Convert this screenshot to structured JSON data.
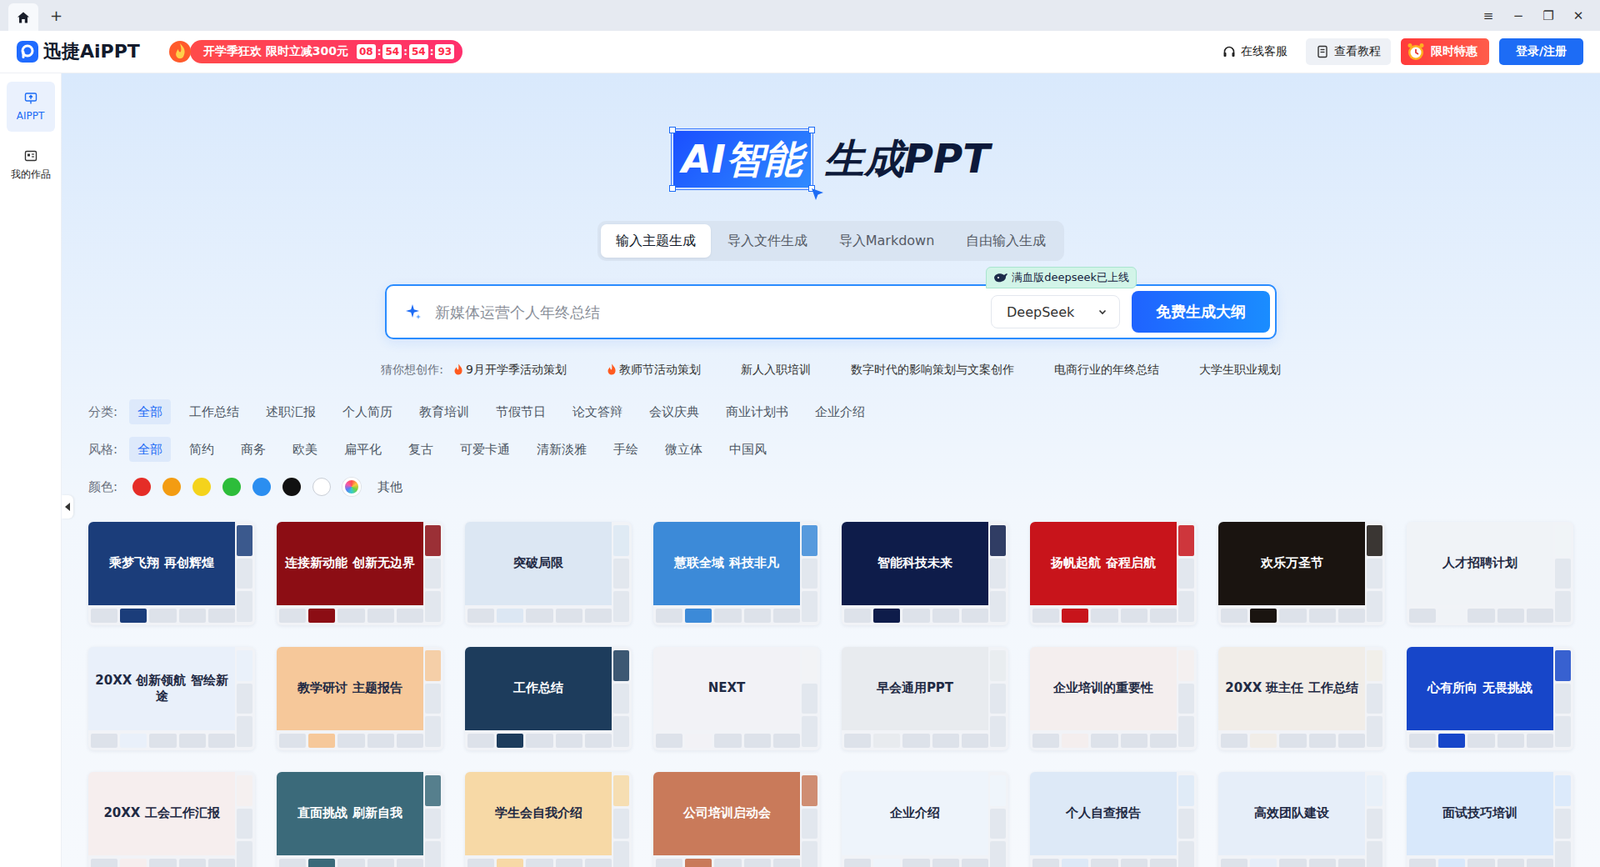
{
  "titlebar": {
    "tabs": [
      {
        "selected": true
      }
    ],
    "add": "+",
    "controls": [
      "≡",
      "−",
      "❐",
      "✕"
    ]
  },
  "app": {
    "logo": "迅捷AiPPT"
  },
  "promo": {
    "text": "开学季狂欢 限时立减300元",
    "countdown": [
      "08",
      "54",
      "54",
      "93"
    ],
    "separator": ":"
  },
  "header_actions": [
    {
      "label": "在线客服",
      "kind": "service"
    },
    {
      "label": "查看教程",
      "kind": "tutorial"
    },
    {
      "label": "限时特惠",
      "kind": "promo"
    },
    {
      "label": "登录/注册",
      "kind": "primary"
    }
  ],
  "sidebar": {
    "items": [
      {
        "label": "AIPPT",
        "selected": true,
        "kind": "aippt"
      },
      {
        "label": "我的作品",
        "selected": false,
        "kind": "works"
      }
    ]
  },
  "hero": {
    "highlight": "AI智能",
    "title": "生成PPT"
  },
  "modes": [
    {
      "label": "输入主题生成",
      "selected": true
    },
    {
      "label": "导入文件生成",
      "selected": false
    },
    {
      "label": "导入Markdown",
      "selected": false
    },
    {
      "label": "自由输入生成",
      "selected": false
    }
  ],
  "badge": "满血版deepseek已上线",
  "search": {
    "placeholder": "新媒体运营个人年终总结",
    "model": "DeepSeek",
    "button": "免费生成大纲"
  },
  "suggestions": {
    "label": "猜你想创作:",
    "items": [
      {
        "text": "9月开学季活动策划",
        "hot": true
      },
      {
        "text": "教师节活动策划",
        "hot": true
      },
      {
        "text": "新人入职培训",
        "hot": false
      },
      {
        "text": "数字时代的影响策划与文案创作",
        "hot": false
      },
      {
        "text": "电商行业的年终总结",
        "hot": false
      },
      {
        "text": "大学生职业规划",
        "hot": false
      }
    ]
  },
  "filters": [
    {
      "label": "分类:",
      "options": [
        {
          "text": "全部",
          "selected": true
        },
        {
          "text": "工作总结",
          "selected": false
        },
        {
          "text": "述职汇报",
          "selected": false
        },
        {
          "text": "个人简历",
          "selected": false
        },
        {
          "text": "教育培训",
          "selected": false
        },
        {
          "text": "节假节日",
          "selected": false
        },
        {
          "text": "论文答辩",
          "selected": false
        },
        {
          "text": "会议庆典",
          "selected": false
        },
        {
          "text": "商业计划书",
          "selected": false
        },
        {
          "text": "企业介绍",
          "selected": false
        }
      ]
    },
    {
      "label": "风格:",
      "options": [
        {
          "text": "全部",
          "selected": true
        },
        {
          "text": "简约",
          "selected": false
        },
        {
          "text": "商务",
          "selected": false
        },
        {
          "text": "欧美",
          "selected": false
        },
        {
          "text": "扁平化",
          "selected": false
        },
        {
          "text": "复古",
          "selected": false
        },
        {
          "text": "可爱卡通",
          "selected": false
        },
        {
          "text": "清新淡雅",
          "selected": false
        },
        {
          "text": "手绘",
          "selected": false
        },
        {
          "text": "微立体",
          "selected": false
        },
        {
          "text": "中国风",
          "selected": false
        }
      ]
    }
  ],
  "colors": {
    "label": "颜色:",
    "swatches": [
      {
        "kind": "solid",
        "color": "#e52d27",
        "selected": false
      },
      {
        "kind": "solid",
        "color": "#f39c12",
        "selected": false
      },
      {
        "kind": "solid",
        "color": "#f4d31c",
        "selected": false
      },
      {
        "kind": "solid",
        "color": "#2dbd3a",
        "selected": false
      },
      {
        "kind": "solid",
        "color": "#2b8ef0",
        "selected": false
      },
      {
        "kind": "solid",
        "color": "#111111",
        "selected": false
      },
      {
        "kind": "solid",
        "color": "#ffffff",
        "selected": false
      },
      {
        "kind": "multi",
        "selected": false
      }
    ],
    "other": "其他"
  },
  "templates": [
    {
      "title": "乘梦飞翔 再创辉煌",
      "color": "#1b3d7a"
    },
    {
      "title": "连接新动能 创新无边界",
      "color": "#8c0d14"
    },
    {
      "title": "突破局限",
      "color": "#dce7f3"
    },
    {
      "title": "慧联全域 科技非凡",
      "color": "#3c8ad8"
    },
    {
      "title": "智能科技未来",
      "color": "#0e1c4a"
    },
    {
      "title": "扬帆起航 奋程启航",
      "color": "#c8141b"
    },
    {
      "title": "欢乐万圣节",
      "color": "#1a1410"
    },
    {
      "title": "人才招聘计划",
      "color": "#f0f3f7"
    },
    {
      "title": "20XX 创新领航 智绘新途",
      "color": "#e9f0fa"
    },
    {
      "title": "教学研讨 主题报告",
      "color": "#f6c89a"
    },
    {
      "title": "工作总结",
      "color": "#1d3c5c"
    },
    {
      "title": "NEXT",
      "color": "#f2f2f6"
    },
    {
      "title": "早会通用PPT",
      "color": "#e8ebef"
    },
    {
      "title": "企业培训的重要性",
      "color": "#f4eeee"
    },
    {
      "title": "20XX 班主任 工作总结",
      "color": "#f1ede8"
    },
    {
      "title": "心有所向 无畏挑战",
      "color": "#1746c9"
    },
    {
      "title": "20XX 工会工作汇报",
      "color": "#f6eeee"
    },
    {
      "title": "直面挑战 刷新自我",
      "color": "#3b6a7a"
    },
    {
      "title": "学生会自我介绍",
      "color": "#f7d9a6"
    },
    {
      "title": "公司培训启动会",
      "color": "#c97a5a"
    },
    {
      "title": "企业介绍",
      "color": "#eef4fb"
    },
    {
      "title": "个人自查报告",
      "color": "#dde9f7"
    },
    {
      "title": "高效团队建设",
      "color": "#e6eef9"
    },
    {
      "title": "面试技巧培训",
      "color": "#d8e8fb"
    }
  ]
}
